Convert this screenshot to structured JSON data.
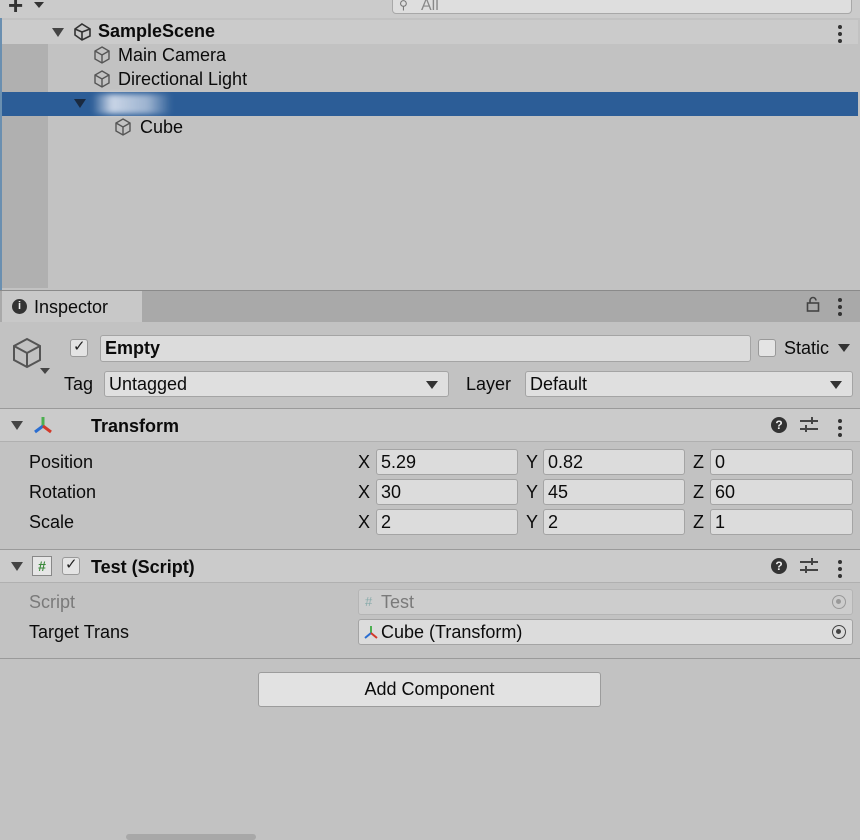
{
  "toolbar": {
    "add_label": "+",
    "search_placeholder": "All"
  },
  "hierarchy": {
    "scene_name": "SampleScene",
    "items": [
      {
        "label": "Main Camera"
      },
      {
        "label": "Directional Light"
      },
      {
        "label": ""
      },
      {
        "label": "Cube"
      }
    ]
  },
  "inspector": {
    "tab_label": "Inspector",
    "object": {
      "active": true,
      "name": "Empty",
      "static_label": "Static",
      "static_checked": false
    },
    "tag": {
      "label": "Tag",
      "value": "Untagged"
    },
    "layer": {
      "label": "Layer",
      "value": "Default"
    },
    "transform": {
      "title": "Transform",
      "rows": [
        {
          "label": "Position",
          "x": "5.29",
          "y": "0.82",
          "z": "0"
        },
        {
          "label": "Rotation",
          "x": "30",
          "y": "45",
          "z": "60"
        },
        {
          "label": "Scale",
          "x": "2",
          "y": "2",
          "z": "1"
        }
      ],
      "axis": {
        "x": "X",
        "y": "Y",
        "z": "Z"
      }
    },
    "script_component": {
      "title": "Test (Script)",
      "enabled": true,
      "script_label": "Script",
      "script_value": "Test",
      "target_label": "Target Trans",
      "target_value": "Cube (Transform)"
    },
    "add_component_label": "Add Component"
  },
  "colors": {
    "selection": "#2c5d97",
    "panel_bg": "#c2c2c2",
    "header_bg": "#cbcbcb"
  }
}
